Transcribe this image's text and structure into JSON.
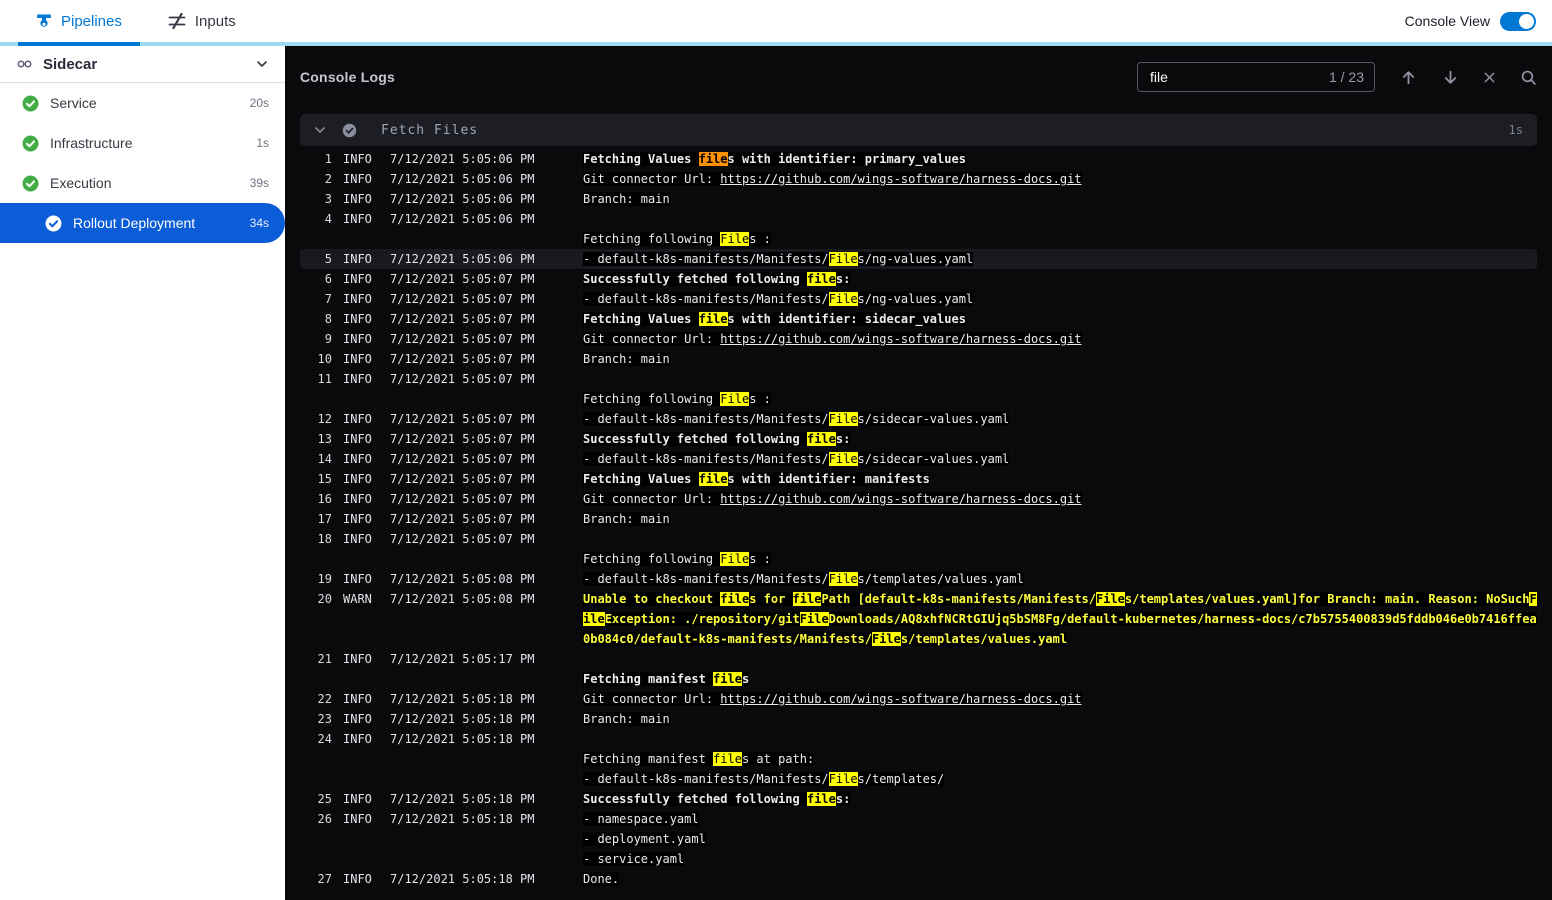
{
  "header": {
    "tabs": [
      {
        "label": "Pipelines",
        "active": true
      },
      {
        "label": "Inputs",
        "active": false
      }
    ],
    "console_view_label": "Console View",
    "console_view_on": true
  },
  "sidebar": {
    "title": "Sidecar",
    "items": [
      {
        "label": "Service",
        "duration": "20s",
        "status": "success",
        "selected": false
      },
      {
        "label": "Infrastructure",
        "duration": "1s",
        "status": "success",
        "selected": false
      },
      {
        "label": "Execution",
        "duration": "39s",
        "status": "success",
        "selected": false
      },
      {
        "label": "Rollout Deployment",
        "duration": "34s",
        "status": "success",
        "selected": true
      }
    ]
  },
  "console": {
    "title": "Console Logs",
    "search": {
      "value": "file",
      "counter": "1 / 23"
    },
    "section": {
      "title": "Fetch Files",
      "duration": "1s"
    },
    "logs": [
      {
        "n": "1",
        "lvl": "INFO",
        "t": "7/12/2021 5:05:06 PM",
        "rows": [
          [
            [
              "Fetching Values ",
              "b"
            ],
            [
              "file",
              "cur b"
            ],
            [
              "s with identifier: primary_values",
              "b"
            ]
          ]
        ]
      },
      {
        "n": "2",
        "lvl": "INFO",
        "t": "7/12/2021 5:05:06 PM",
        "rows": [
          [
            [
              "Git connector Url: ",
              ""
            ],
            [
              "https://github.com/wings-software/harness-docs.git",
              "link"
            ]
          ]
        ]
      },
      {
        "n": "3",
        "lvl": "INFO",
        "t": "7/12/2021 5:05:06 PM",
        "rows": [
          [
            [
              "Branch: main",
              ""
            ]
          ]
        ]
      },
      {
        "n": "4",
        "lvl": "INFO",
        "t": "7/12/2021 5:05:06 PM",
        "rows": [
          [],
          [
            [
              "Fetching following ",
              ""
            ],
            [
              "File",
              "hl"
            ],
            [
              "s :",
              ""
            ]
          ]
        ]
      },
      {
        "n": "5",
        "lvl": "INFO",
        "t": "7/12/2021 5:05:06 PM",
        "active": true,
        "rows": [
          [
            [
              "- default-k8s-manifests/Manifests/",
              ""
            ],
            [
              "File",
              "hl"
            ],
            [
              "s/ng-values.yaml",
              ""
            ]
          ]
        ]
      },
      {
        "n": "6",
        "lvl": "INFO",
        "t": "7/12/2021 5:05:07 PM",
        "rows": [
          [
            [
              "Successfully fetched following ",
              "b"
            ],
            [
              "file",
              "hl b"
            ],
            [
              "s:",
              "b"
            ]
          ]
        ]
      },
      {
        "n": "7",
        "lvl": "INFO",
        "t": "7/12/2021 5:05:07 PM",
        "rows": [
          [
            [
              "- default-k8s-manifests/Manifests/",
              ""
            ],
            [
              "File",
              "hl"
            ],
            [
              "s/ng-values.yaml",
              ""
            ]
          ]
        ]
      },
      {
        "n": "8",
        "lvl": "INFO",
        "t": "7/12/2021 5:05:07 PM",
        "rows": [
          [
            [
              "Fetching Values ",
              "b"
            ],
            [
              "file",
              "hl b"
            ],
            [
              "s with identifier: sidecar_values",
              "b"
            ]
          ]
        ]
      },
      {
        "n": "9",
        "lvl": "INFO",
        "t": "7/12/2021 5:05:07 PM",
        "rows": [
          [
            [
              "Git connector Url: ",
              ""
            ],
            [
              "https://github.com/wings-software/harness-docs.git",
              "link"
            ]
          ]
        ]
      },
      {
        "n": "10",
        "lvl": "INFO",
        "t": "7/12/2021 5:05:07 PM",
        "rows": [
          [
            [
              "Branch: main",
              ""
            ]
          ]
        ]
      },
      {
        "n": "11",
        "lvl": "INFO",
        "t": "7/12/2021 5:05:07 PM",
        "rows": [
          [],
          [
            [
              "Fetching following ",
              ""
            ],
            [
              "File",
              "hl"
            ],
            [
              "s :",
              ""
            ]
          ]
        ]
      },
      {
        "n": "12",
        "lvl": "INFO",
        "t": "7/12/2021 5:05:07 PM",
        "rows": [
          [
            [
              "- default-k8s-manifests/Manifests/",
              ""
            ],
            [
              "File",
              "hl"
            ],
            [
              "s/sidecar-values.yaml",
              ""
            ]
          ]
        ]
      },
      {
        "n": "13",
        "lvl": "INFO",
        "t": "7/12/2021 5:05:07 PM",
        "rows": [
          [
            [
              "Successfully fetched following ",
              "b"
            ],
            [
              "file",
              "hl b"
            ],
            [
              "s:",
              "b"
            ]
          ]
        ]
      },
      {
        "n": "14",
        "lvl": "INFO",
        "t": "7/12/2021 5:05:07 PM",
        "rows": [
          [
            [
              "- default-k8s-manifests/Manifests/",
              ""
            ],
            [
              "File",
              "hl"
            ],
            [
              "s/sidecar-values.yaml",
              ""
            ]
          ]
        ]
      },
      {
        "n": "15",
        "lvl": "INFO",
        "t": "7/12/2021 5:05:07 PM",
        "rows": [
          [
            [
              "Fetching Values ",
              "b"
            ],
            [
              "file",
              "hl b"
            ],
            [
              "s with identifier: manifests",
              "b"
            ]
          ]
        ]
      },
      {
        "n": "16",
        "lvl": "INFO",
        "t": "7/12/2021 5:05:07 PM",
        "rows": [
          [
            [
              "Git connector Url: ",
              ""
            ],
            [
              "https://github.com/wings-software/harness-docs.git",
              "link"
            ]
          ]
        ]
      },
      {
        "n": "17",
        "lvl": "INFO",
        "t": "7/12/2021 5:05:07 PM",
        "rows": [
          [
            [
              "Branch: main",
              ""
            ]
          ]
        ]
      },
      {
        "n": "18",
        "lvl": "INFO",
        "t": "7/12/2021 5:05:07 PM",
        "rows": [
          [],
          [
            [
              "Fetching following ",
              ""
            ],
            [
              "File",
              "hl"
            ],
            [
              "s :",
              ""
            ]
          ]
        ]
      },
      {
        "n": "19",
        "lvl": "INFO",
        "t": "7/12/2021 5:05:08 PM",
        "rows": [
          [
            [
              "- default-k8s-manifests/Manifests/",
              ""
            ],
            [
              "File",
              "hl"
            ],
            [
              "s/templates/values.yaml",
              ""
            ]
          ]
        ]
      },
      {
        "n": "20",
        "lvl": "WARN",
        "t": "7/12/2021 5:05:08 PM",
        "wrap": true,
        "rows": [
          [
            [
              "Unable to checkout ",
              "w b"
            ],
            [
              "file",
              "hl b"
            ],
            [
              "s for ",
              "w b"
            ],
            [
              "file",
              "hl b"
            ],
            [
              "Path [default-k8s-manifests/Manifests/",
              "w b"
            ],
            [
              "File",
              "hl b"
            ],
            [
              "s/templates/values.yaml]for Branch: main. Reason: NoSuch",
              "w b"
            ],
            [
              "File",
              "hl b"
            ],
            [
              "Exception: ./repository/git",
              "w b"
            ],
            [
              "File",
              "hl b"
            ],
            [
              "Downloads/AQ8xhfNCRtGIUjq5bSM8Fg/default-kubernetes/harness-docs/c7b5755400839d5fddb046e0b7416ffea0b084c0/default-k8s-manifests/Manifests/",
              "w b"
            ],
            [
              "File",
              "hl b"
            ],
            [
              "s/templates/values.yaml",
              "w b"
            ]
          ]
        ]
      },
      {
        "n": "21",
        "lvl": "INFO",
        "t": "7/12/2021 5:05:17 PM",
        "rows": [
          [],
          [
            [
              "Fetching manifest ",
              "b"
            ],
            [
              "file",
              "hl b"
            ],
            [
              "s",
              "b"
            ]
          ]
        ]
      },
      {
        "n": "22",
        "lvl": "INFO",
        "t": "7/12/2021 5:05:18 PM",
        "rows": [
          [
            [
              "Git connector Url: ",
              ""
            ],
            [
              "https://github.com/wings-software/harness-docs.git",
              "link"
            ]
          ]
        ]
      },
      {
        "n": "23",
        "lvl": "INFO",
        "t": "7/12/2021 5:05:18 PM",
        "rows": [
          [
            [
              "Branch: main",
              ""
            ]
          ]
        ]
      },
      {
        "n": "24",
        "lvl": "INFO",
        "t": "7/12/2021 5:05:18 PM",
        "rows": [
          [],
          [
            [
              "Fetching manifest ",
              ""
            ],
            [
              "file",
              "hl"
            ],
            [
              "s at path:",
              ""
            ]
          ],
          [
            [
              "- default-k8s-manifests/Manifests/",
              ""
            ],
            [
              "File",
              "hl"
            ],
            [
              "s/templates/",
              ""
            ]
          ]
        ]
      },
      {
        "n": "25",
        "lvl": "INFO",
        "t": "7/12/2021 5:05:18 PM",
        "rows": [
          [
            [
              "Successfully fetched following ",
              "b"
            ],
            [
              "file",
              "hl b"
            ],
            [
              "s:",
              "b"
            ]
          ]
        ]
      },
      {
        "n": "26",
        "lvl": "INFO",
        "t": "7/12/2021 5:05:18 PM",
        "rows": [
          [
            [
              "- namespace.yaml",
              ""
            ]
          ],
          [
            [
              "- deployment.yaml",
              ""
            ]
          ],
          [
            [
              "- service.yaml",
              ""
            ]
          ]
        ]
      },
      {
        "n": "27",
        "lvl": "INFO",
        "t": "7/12/2021 5:05:18 PM",
        "rows": [
          [
            [
              "Done.",
              ""
            ]
          ]
        ]
      }
    ]
  },
  "colors": {
    "brand": "#0278d5",
    "selected": "#0b5cd7",
    "success": "#42ab45",
    "highlight": "#ffff00",
    "current": "#ff9100",
    "warn": "#ffff3d",
    "headerline": "#9bdcf3",
    "consolebg": "#0a0a0c"
  }
}
